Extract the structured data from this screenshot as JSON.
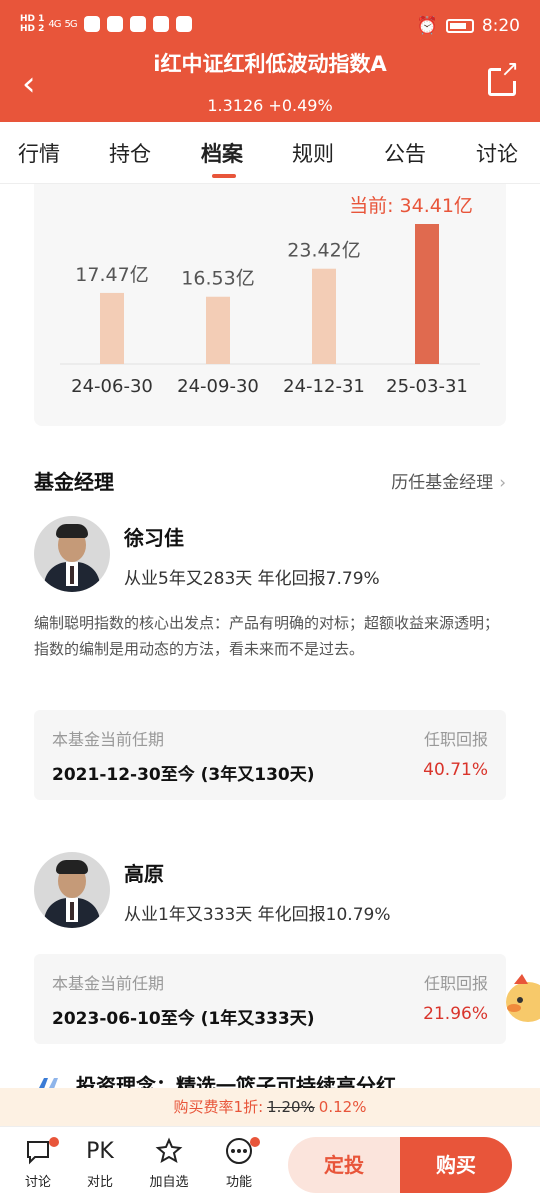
{
  "status": {
    "left_labels": [
      "HD 1",
      "HD 2"
    ],
    "signal": [
      "4G",
      "5G"
    ],
    "time": "8:20"
  },
  "header": {
    "title": "i红中证红利低波动指数A",
    "nav_value": "1.3126",
    "nav_change": "+0.49%"
  },
  "tabs": [
    {
      "label": "行情"
    },
    {
      "label": "持仓"
    },
    {
      "label": "档案"
    },
    {
      "label": "规则"
    },
    {
      "label": "公告"
    },
    {
      "label": "讨论"
    }
  ],
  "chart_data": {
    "type": "bar",
    "categories": [
      "24-06-30",
      "24-09-30",
      "24-12-31",
      "25-03-31"
    ],
    "values": [
      17.47,
      16.53,
      23.42,
      34.41
    ],
    "value_labels": [
      "17.47亿",
      "16.53亿",
      "23.42亿",
      "当前: 34.41亿"
    ],
    "unit": "亿",
    "colors": {
      "normal": "#f3cdb6",
      "current": "#e06a4f",
      "current_label": "#e8553a"
    }
  },
  "managers": {
    "title": "基金经理",
    "history_link": "历任基金经理",
    "list": [
      {
        "name": "徐习佳",
        "stats": "从业5年又283天 年化回报7.79%",
        "desc": "编制聪明指数的核心出发点：产品有明确的对标；超额收益来源透明；指数的编制是用动态的方法，看未来而不是过去。",
        "tenure_label": "本基金当前任期",
        "tenure_value": "2021-12-30至今 (3年又130天)",
        "return_label": "任职回报",
        "return_value": "40.71%"
      },
      {
        "name": "高原",
        "stats": "从业1年又333天 年化回报10.79%",
        "tenure_label": "本基金当前任期",
        "tenure_value": "2023-06-10至今 (1年又333天)",
        "return_label": "任职回报",
        "return_value": "21.96%"
      }
    ],
    "philosophy": "投资理念：精选一篮子可持续高分红"
  },
  "fee": {
    "prefix": "购买费率1折:",
    "original": "1.20%",
    "discounted": "0.12%"
  },
  "bottom_nav": [
    {
      "label": "讨论",
      "icon": "chat-icon"
    },
    {
      "label": "对比",
      "icon_text": "PK"
    },
    {
      "label": "加自选",
      "icon": "star-add-icon"
    },
    {
      "label": "功能",
      "icon": "more-icon"
    }
  ],
  "buttons": {
    "dingtou": "定投",
    "buy": "购买"
  }
}
